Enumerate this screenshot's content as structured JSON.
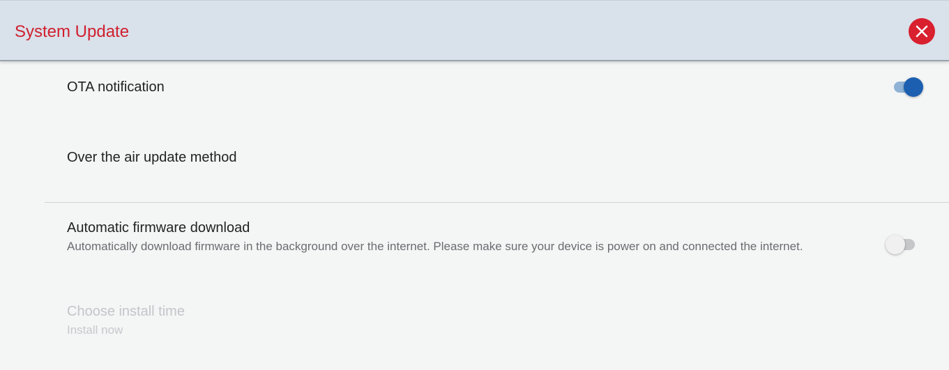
{
  "header": {
    "title": "System Update",
    "close_icon": "close-icon",
    "accent_color": "#d0202f"
  },
  "settings": {
    "ota_notification": {
      "label": "OTA notification",
      "enabled": true
    },
    "ota_method": {
      "label": "Over the air update method"
    },
    "auto_download": {
      "label": "Automatic firmware download",
      "description": "Automatically download firmware in the background over the internet. Please make sure your device is power on and connected the internet.",
      "enabled": false
    },
    "install_time": {
      "label": "Choose install time",
      "value": "Install now",
      "disabled": true
    }
  },
  "colors": {
    "toggle_on_thumb": "#1c5fb0",
    "toggle_on_track": "#8fb2d6",
    "toggle_off_track": "#c5c7c9"
  }
}
